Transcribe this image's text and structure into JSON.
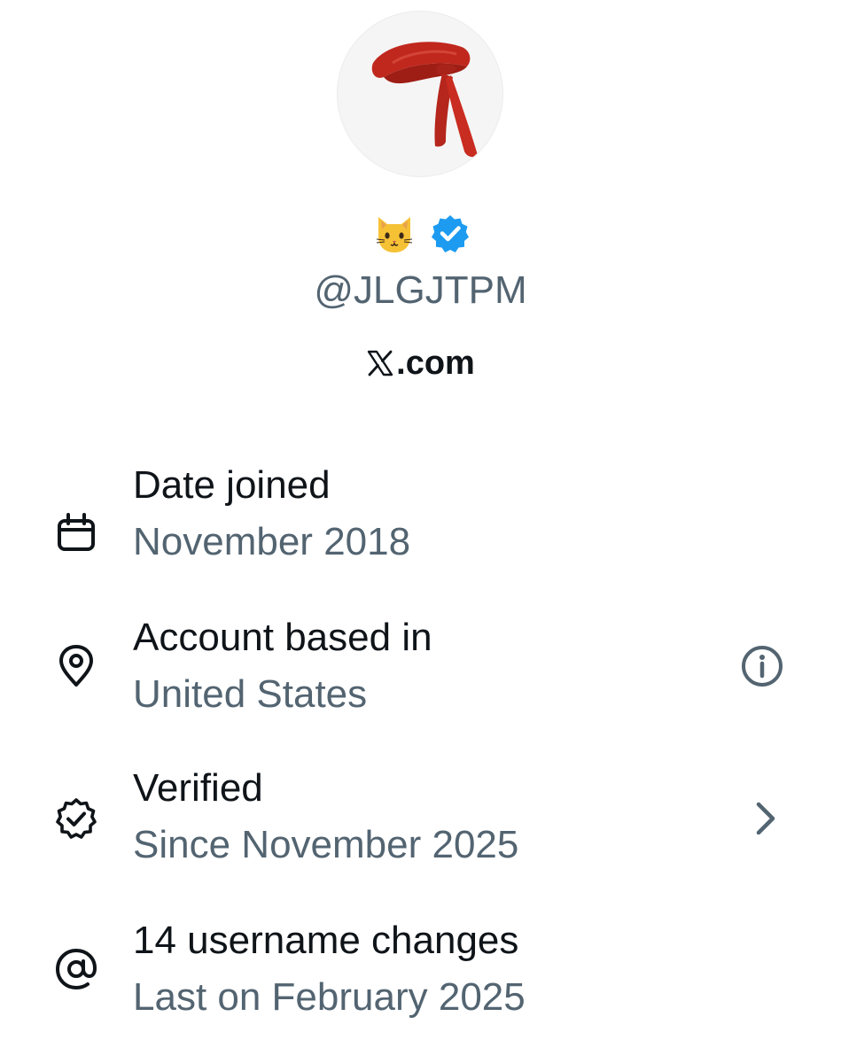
{
  "profile": {
    "avatar_icon": "red-headband-icon",
    "name_emoji_icon": "cat-face-icon",
    "verified_badge_icon": "blue-verified-badge-icon",
    "verified_color": "#1d9bf0",
    "handle": "@JLGJTPM",
    "site_icon": "x-logo-icon",
    "site_text": ".com"
  },
  "details": [
    {
      "icon": "calendar-icon",
      "title": "Date joined",
      "subtitle": "November 2018"
    },
    {
      "icon": "location-pin-icon",
      "title": "Account based in",
      "subtitle": "United States",
      "trailing_icon": "info-icon"
    },
    {
      "icon": "verified-badge-outline-icon",
      "title": "Verified",
      "subtitle": "Since November 2025",
      "trailing_icon": "chevron-right-icon"
    },
    {
      "icon": "at-sign-icon",
      "title": "14 username changes",
      "subtitle": "Last on February 2025"
    }
  ],
  "colors": {
    "text_primary": "#0f1419",
    "text_secondary": "#536471",
    "accent": "#1d9bf0",
    "avatar_bg": "#f5f5f5"
  }
}
